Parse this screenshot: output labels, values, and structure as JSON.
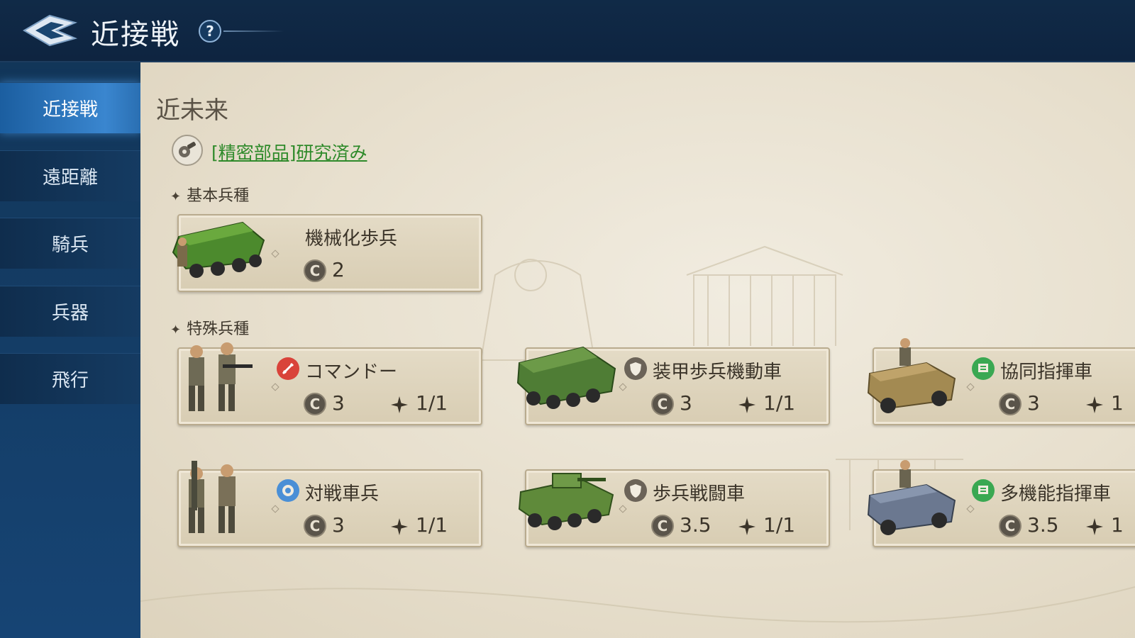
{
  "header": {
    "title": "近接戦",
    "help_label": "?"
  },
  "sidebar": {
    "items": [
      {
        "label": "近接戦",
        "active": true
      },
      {
        "label": "遠距離",
        "active": false
      },
      {
        "label": "騎兵",
        "active": false
      },
      {
        "label": "兵器",
        "active": false
      },
      {
        "label": "飛行",
        "active": false
      }
    ]
  },
  "main": {
    "section_title": "近未来",
    "research_text": "[精密部品]研究済み",
    "basic_label": "基本兵種",
    "special_label": "特殊兵種",
    "basic_units": [
      {
        "name": "機械化歩兵",
        "cost_symbol": "C",
        "cost": "2",
        "icon": "mechanized-vehicle-icon"
      }
    ],
    "special_units": [
      {
        "name": "コマンドー",
        "cost_symbol": "C",
        "cost": "3",
        "limit": "1/1",
        "type_icon": "sword-icon",
        "type_color": "#d9433a"
      },
      {
        "name": "装甲歩兵機動車",
        "cost_symbol": "C",
        "cost": "3",
        "limit": "1/1",
        "type_icon": "shield-icon",
        "type_color": "#6b6358"
      },
      {
        "name": "協同指揮車",
        "cost_symbol": "C",
        "cost": "3",
        "limit": "1",
        "type_icon": "support-icon",
        "type_color": "#3aa852"
      },
      {
        "name": "対戦車兵",
        "cost_symbol": "C",
        "cost": "3",
        "limit": "1/1",
        "type_icon": "ranged-icon",
        "type_color": "#4a8fd6"
      },
      {
        "name": "歩兵戦闘車",
        "cost_symbol": "C",
        "cost": "3.5",
        "limit": "1/1",
        "type_icon": "shield-icon",
        "type_color": "#6b6358"
      },
      {
        "name": "多機能指揮車",
        "cost_symbol": "C",
        "cost": "3.5",
        "limit": "1",
        "type_icon": "support-icon",
        "type_color": "#3aa852"
      }
    ]
  },
  "colors": {
    "header_bg": "#0e2440",
    "sidebar_active": "#3a86cf",
    "parchment": "#e7dfcd",
    "research_link": "#2e8a2a"
  }
}
